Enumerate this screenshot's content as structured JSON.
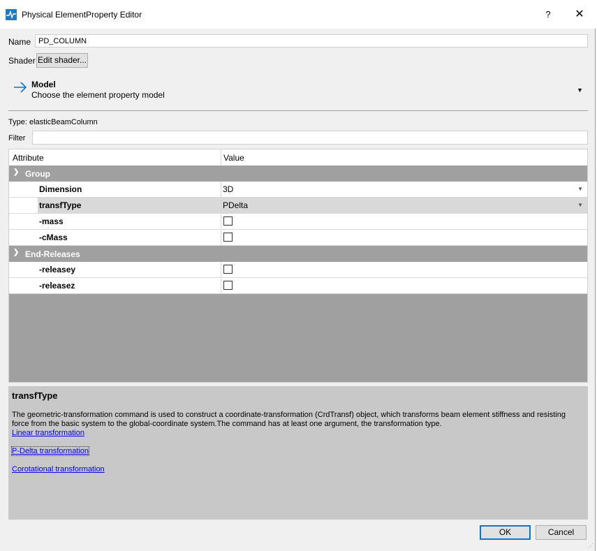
{
  "window": {
    "title": "Physical ElementProperty Editor",
    "help_label": "?",
    "close_label": "✕"
  },
  "name_field": {
    "label": "Name",
    "value": "PD_COLUMN"
  },
  "shader": {
    "label": "Shader",
    "button_label": "Edit shader..."
  },
  "model": {
    "title": "Model",
    "subtitle": "Choose the element property model",
    "dropdown_glyph": "▼"
  },
  "type_line": "Type:  elasticBeamColumn",
  "filter": {
    "label": "Filter",
    "value": ""
  },
  "table": {
    "headers": [
      "Attribute",
      "Value"
    ],
    "groups": [
      {
        "name": "Group",
        "rows": [
          {
            "name": "Dimension",
            "kind": "combo",
            "value": "3D",
            "selected": false
          },
          {
            "name": "transfType",
            "kind": "combo",
            "value": "PDelta",
            "selected": true
          },
          {
            "name": "-mass",
            "kind": "checkbox",
            "checked": false
          },
          {
            "name": "-cMass",
            "kind": "checkbox",
            "checked": false
          }
        ]
      },
      {
        "name": "End-Releases",
        "rows": [
          {
            "name": "-releasey",
            "kind": "checkbox",
            "checked": false
          },
          {
            "name": "-releasez",
            "kind": "checkbox",
            "checked": false
          }
        ]
      }
    ]
  },
  "description": {
    "title": "transfType",
    "text": "The geometric-transformation command is used to construct a coordinate-transformation (CrdTransf) object, which transforms beam element stiffness and resisting force from the basic system to the global-coordinate system.The command has at least one argument, the transformation type.",
    "links": [
      "Linear transformation",
      "P-Delta transformation",
      "Corotational transformation"
    ]
  },
  "buttons": {
    "ok": "OK",
    "cancel": "Cancel"
  },
  "colors": {
    "accent": "#0078d7",
    "group_bg": "#a0a0a0",
    "link": "#0000ee",
    "icon": "#1c7bc4"
  }
}
